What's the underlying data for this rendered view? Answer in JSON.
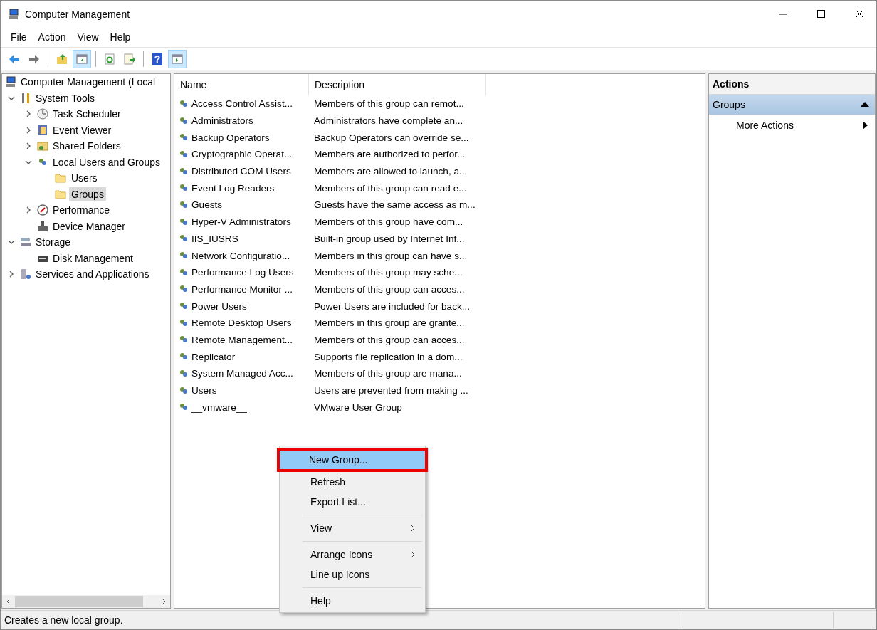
{
  "window": {
    "title": "Computer Management"
  },
  "menu_bar": [
    "File",
    "Action",
    "View",
    "Help"
  ],
  "toolbar": [
    {
      "kind": "back",
      "pressed": false
    },
    {
      "kind": "forward",
      "pressed": false
    },
    {
      "kind": "separator"
    },
    {
      "kind": "up",
      "pressed": false
    },
    {
      "kind": "tree",
      "pressed": true
    },
    {
      "kind": "separator"
    },
    {
      "kind": "refresh",
      "pressed": false
    },
    {
      "kind": "export",
      "pressed": false
    },
    {
      "kind": "separator"
    },
    {
      "kind": "help",
      "label": "?",
      "pressed": false
    },
    {
      "kind": "actions",
      "pressed": true
    }
  ],
  "tree": [
    {
      "label": "Computer Management (Local",
      "kind": "computer",
      "selected": false,
      "children": [
        {
          "label": "System Tools",
          "kind": "tools",
          "expanded": true,
          "selected": false,
          "children": [
            {
              "label": "Task Scheduler",
              "kind": "clock",
              "expanded": false,
              "selected": false
            },
            {
              "label": "Event Viewer",
              "kind": "log",
              "expanded": false,
              "selected": false
            },
            {
              "label": "Shared Folders",
              "kind": "share",
              "expanded": false,
              "selected": false
            },
            {
              "label": "Local Users and Groups",
              "kind": "users",
              "expanded": true,
              "selected": false,
              "children": [
                {
                  "label": "Users",
                  "kind": "folder",
                  "selected": false
                },
                {
                  "label": "Groups",
                  "kind": "folder",
                  "selected": true
                }
              ]
            },
            {
              "label": "Performance",
              "kind": "gauge",
              "expanded": false,
              "selected": false
            },
            {
              "label": "Device Manager",
              "kind": "device",
              "selected": false
            }
          ]
        },
        {
          "label": "Storage",
          "kind": "storage",
          "expanded": true,
          "selected": false,
          "children": [
            {
              "label": "Disk Management",
              "kind": "disk",
              "selected": false
            }
          ]
        },
        {
          "label": "Services and Applications",
          "kind": "services",
          "expanded": false,
          "selected": false
        }
      ]
    }
  ],
  "table": {
    "columns": [
      "Name",
      "Description"
    ],
    "rows": [
      {
        "name": "Access Control Assist...",
        "description": "Members of this group can remot..."
      },
      {
        "name": "Administrators",
        "description": "Administrators have complete an..."
      },
      {
        "name": "Backup Operators",
        "description": "Backup Operators can override se..."
      },
      {
        "name": "Cryptographic Operat...",
        "description": "Members are authorized to perfor..."
      },
      {
        "name": "Distributed COM Users",
        "description": "Members are allowed to launch, a..."
      },
      {
        "name": "Event Log Readers",
        "description": "Members of this group can read e..."
      },
      {
        "name": "Guests",
        "description": "Guests have the same access as m..."
      },
      {
        "name": "Hyper-V Administrators",
        "description": "Members of this group have com..."
      },
      {
        "name": "IIS_IUSRS",
        "description": "Built-in group used by Internet Inf..."
      },
      {
        "name": "Network Configuratio...",
        "description": "Members in this group can have s..."
      },
      {
        "name": "Performance Log Users",
        "description": "Members of this group may sche..."
      },
      {
        "name": "Performance Monitor ...",
        "description": "Members of this group can acces..."
      },
      {
        "name": "Power Users",
        "description": "Power Users are included for back..."
      },
      {
        "name": "Remote Desktop Users",
        "description": "Members in this group are grante..."
      },
      {
        "name": "Remote Management...",
        "description": "Members of this group can acces..."
      },
      {
        "name": "Replicator",
        "description": "Supports file replication in a dom..."
      },
      {
        "name": "System Managed Acc...",
        "description": "Members of this group are mana..."
      },
      {
        "name": "Users",
        "description": "Users are prevented from making ..."
      },
      {
        "name": "__vmware__",
        "description": "VMware User Group"
      }
    ]
  },
  "context_menu": [
    {
      "kind": "item",
      "label": "New Group...",
      "selected": true,
      "outlined": true,
      "submenu": false
    },
    {
      "kind": "item",
      "label": "Refresh",
      "selected": false,
      "outlined": false,
      "submenu": false
    },
    {
      "kind": "item",
      "label": "Export List...",
      "selected": false,
      "outlined": false,
      "submenu": false
    },
    {
      "kind": "separator"
    },
    {
      "kind": "item",
      "label": "View",
      "selected": false,
      "outlined": false,
      "submenu": true
    },
    {
      "kind": "separator"
    },
    {
      "kind": "item",
      "label": "Arrange Icons",
      "selected": false,
      "outlined": false,
      "submenu": true
    },
    {
      "kind": "item",
      "label": "Line up Icons",
      "selected": false,
      "outlined": false,
      "submenu": false
    },
    {
      "kind": "separator"
    },
    {
      "kind": "item",
      "label": "Help",
      "selected": false,
      "outlined": false,
      "submenu": false
    }
  ],
  "actions": {
    "title": "Actions",
    "section": {
      "label": "Groups",
      "expanded": true
    },
    "items": [
      {
        "label": "More Actions",
        "submenu": true
      }
    ]
  },
  "status_bar": {
    "text": "Creates a new local group."
  }
}
